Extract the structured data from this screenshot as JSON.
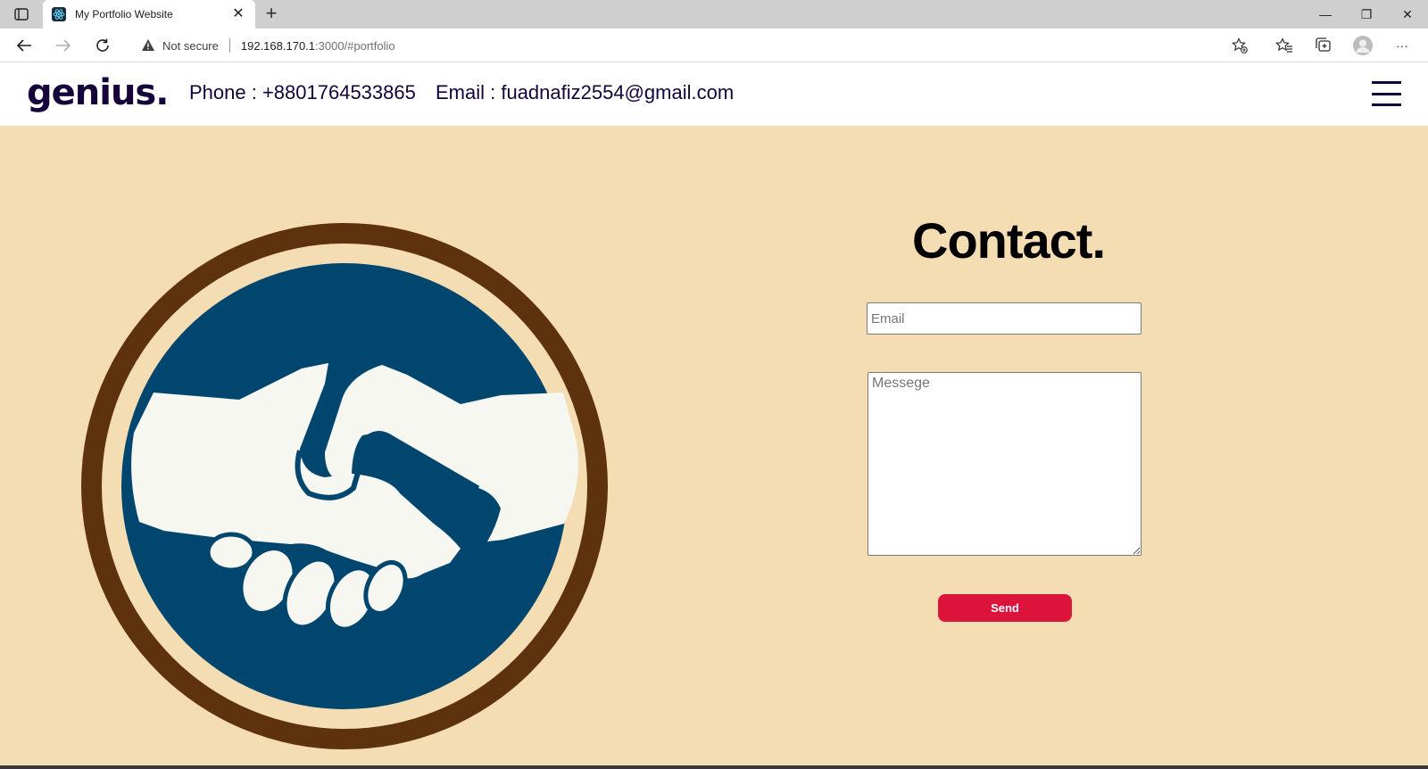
{
  "browser": {
    "tab_title": "My Portfolio Website",
    "tab_close_glyph": "✕",
    "new_tab_glyph": "+",
    "not_secure_label": "Not secure",
    "url_host": "192.168.170.1",
    "url_rest": ":3000/#portfolio",
    "window_controls": {
      "minimize": "—",
      "restore": "❐",
      "close": "✕"
    },
    "more_glyph": "···",
    "icons": [
      "tab-actions-icon",
      "react-favicon",
      "back-icon",
      "forward-icon",
      "refresh-icon",
      "warning-icon",
      "add-favorite-icon",
      "favorites-icon",
      "collections-icon",
      "profile-avatar",
      "more-icon"
    ]
  },
  "header": {
    "logo": "genius.",
    "phone": "Phone : +8801764533865",
    "email": "Email : fuadnafiz2554@gmail.com",
    "menu_icon": "hamburger-icon"
  },
  "contact": {
    "title": "Contact.",
    "email_placeholder": "Email",
    "message_placeholder": "Messege",
    "send_label": "Send",
    "image_icon": "handshake-illustration"
  },
  "colors": {
    "section_bg": "#f5ddb3",
    "navy_text": "#15023a",
    "ring_brown": "#5e320d",
    "circle_blue": "#00466e",
    "hands_white": "#f7f7f2",
    "send_red": "#dc143c"
  }
}
